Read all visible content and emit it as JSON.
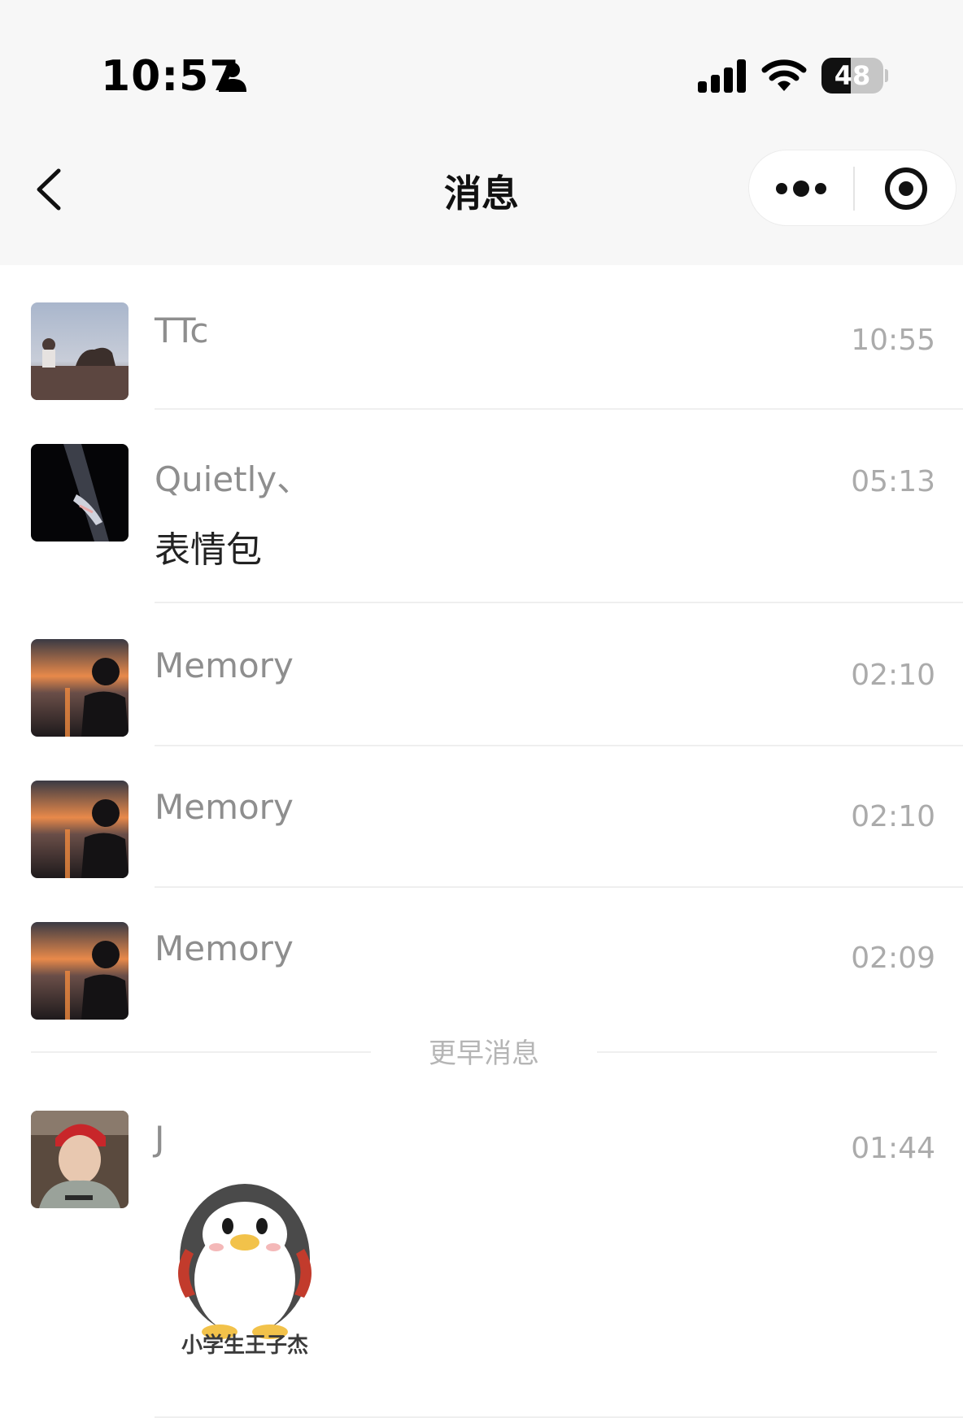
{
  "status_bar": {
    "time": "10:57",
    "battery": "48",
    "battery_level": 0.48
  },
  "header": {
    "title": "消息",
    "icons": {
      "back": "chevron-left-icon",
      "more": "more-dots-icon",
      "close": "target-close-icon"
    }
  },
  "messages": [
    {
      "name": "TTc",
      "time": "10:55"
    },
    {
      "name": "Quietly、",
      "time": "05:13",
      "text": "表情包"
    },
    {
      "name": "Memory",
      "time": "02:10"
    },
    {
      "name": "Memory",
      "time": "02:10"
    },
    {
      "name": "Memory",
      "time": "02:09"
    }
  ],
  "earlier_label": "更早消息",
  "earlier_messages": [
    {
      "name": "J",
      "time": "01:44",
      "sticker_caption": "小学生王子杰"
    }
  ],
  "colors": {
    "header_bg": "#f7f7f7",
    "name_gray": "#8e8e8e",
    "time_gray": "#ababab"
  }
}
